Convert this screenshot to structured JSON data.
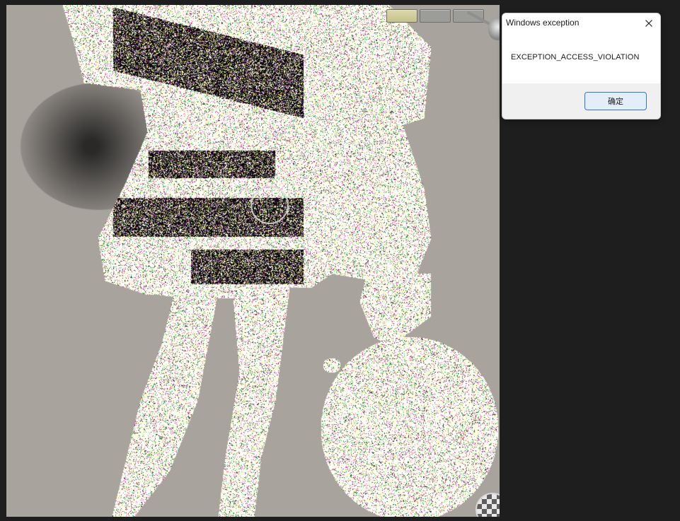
{
  "viewport": {
    "background_color": "#a9a39d",
    "tabs": [
      {
        "state": "active"
      },
      {
        "state": "inactive"
      },
      {
        "state": "inactive"
      }
    ],
    "brush_cursor_icon": "circle-brush-cursor",
    "nav_gizmo_icon": "checker-navigation-ball"
  },
  "dialog": {
    "title": "Windows exception",
    "close_icon": "close-icon",
    "message": "EXCEPTION_ACCESS_VIOLATION",
    "ok_button_label": "确定",
    "accent_color": "#2d7bd1"
  },
  "page": {
    "background_color": "#1e1e1e"
  }
}
